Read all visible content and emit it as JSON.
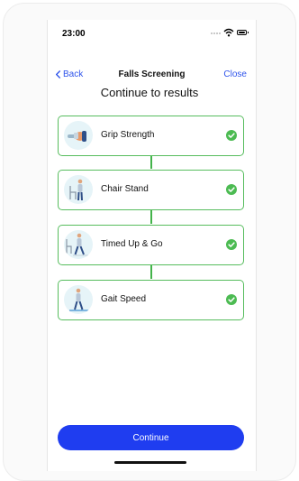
{
  "status_bar": {
    "time": "23:00"
  },
  "nav": {
    "back_label": "Back",
    "title": "Falls Screening",
    "close_label": "Close"
  },
  "page": {
    "title": "Continue to results"
  },
  "steps": [
    {
      "label": "Grip Strength",
      "icon": "grip-strength-illustration",
      "status": "complete"
    },
    {
      "label": "Chair Stand",
      "icon": "chair-stand-illustration",
      "status": "complete"
    },
    {
      "label": "Timed Up & Go",
      "icon": "timed-up-and-go-illustration",
      "status": "complete"
    },
    {
      "label": "Gait Speed",
      "icon": "gait-speed-illustration",
      "status": "complete"
    }
  ],
  "actions": {
    "continue_label": "Continue"
  },
  "colors": {
    "accent": "#1f3df0",
    "link": "#2f54eb",
    "success": "#4cbb52",
    "card_border": "#57bd5e",
    "thumb_bg": "#e6f4f8"
  }
}
